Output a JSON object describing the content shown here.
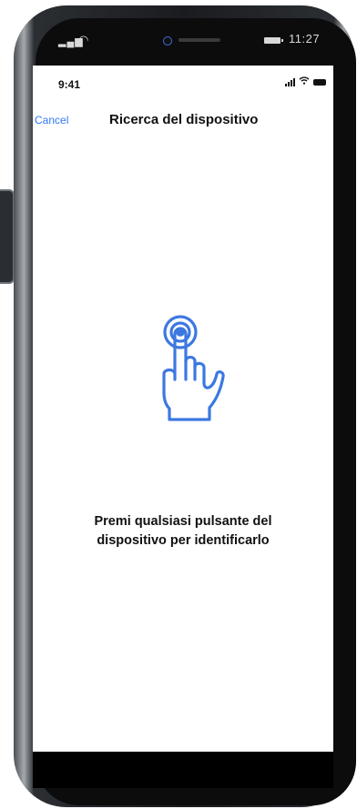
{
  "device": {
    "system_status": {
      "time": "11:27",
      "signal_icon": "signal-bars-icon",
      "wifi_icon": "wifi-icon",
      "battery_icon": "battery-icon"
    }
  },
  "app": {
    "status_bar": {
      "time": "9:41",
      "signal_icon": "signal-bars-icon",
      "wifi_icon": "wifi-icon",
      "battery_icon": "battery-icon"
    },
    "nav": {
      "cancel_label": "Cancel",
      "title": "Ricerca del dispositivo"
    },
    "illustration": {
      "icon": "hand-tap-icon",
      "color": "#3d78e0"
    },
    "message": {
      "line1": "Premi qualsiasi pulsante del",
      "line2": "dispositivo per identificarlo"
    }
  },
  "colors": {
    "accent": "#3478f6",
    "text": "#111111",
    "icon": "#3d78e0"
  }
}
